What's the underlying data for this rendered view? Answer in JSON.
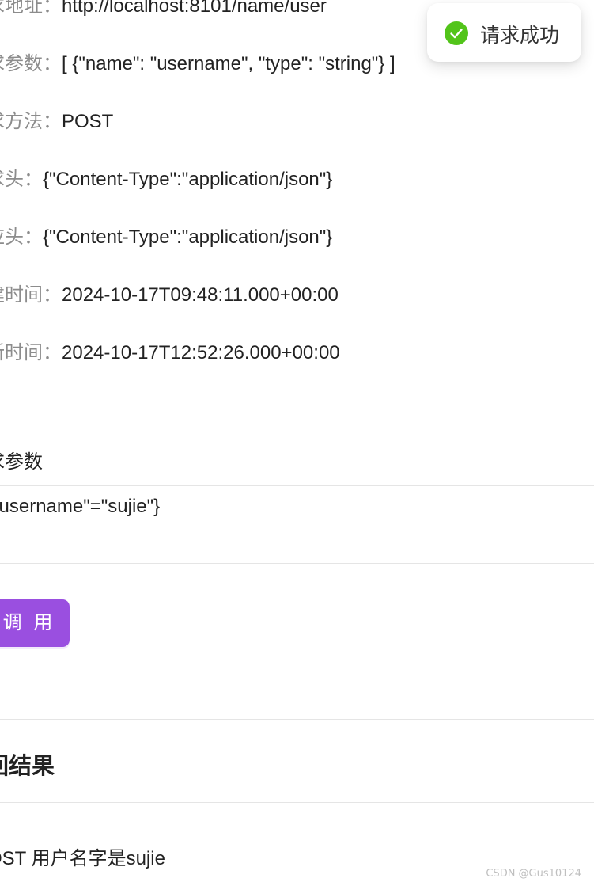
{
  "details": {
    "url": {
      "label": "求地址：",
      "value": "http://localhost:8101/name/user"
    },
    "params": {
      "label": "求参数：",
      "value": "[ {\"name\": \"username\", \"type\": \"string\"} ]"
    },
    "method": {
      "label": "求方法：",
      "value": "POST"
    },
    "request_header": {
      "label": "求头：",
      "value": "{\"Content-Type\":\"application/json\"}"
    },
    "response_header": {
      "label": "应头：",
      "value": "{\"Content-Type\":\"application/json\"}"
    },
    "created": {
      "label": "建时间：",
      "value": "2024-10-17T09:48:11.000+00:00"
    },
    "updated": {
      "label": "新时间：",
      "value": "2024-10-17T12:52:26.000+00:00"
    }
  },
  "request_section": {
    "title": "求参数",
    "params_value": "\"username\"=\"sujie\"}"
  },
  "invoke_button": {
    "label": "调 用",
    "color": "#9a4fe0"
  },
  "result_section": {
    "title": "回结果",
    "value": "OST 用户名字是sujie"
  },
  "toast": {
    "icon": "check-circle-icon",
    "message": "请求成功",
    "color": "#52c41a"
  },
  "watermark": "CSDN @Gus10124"
}
